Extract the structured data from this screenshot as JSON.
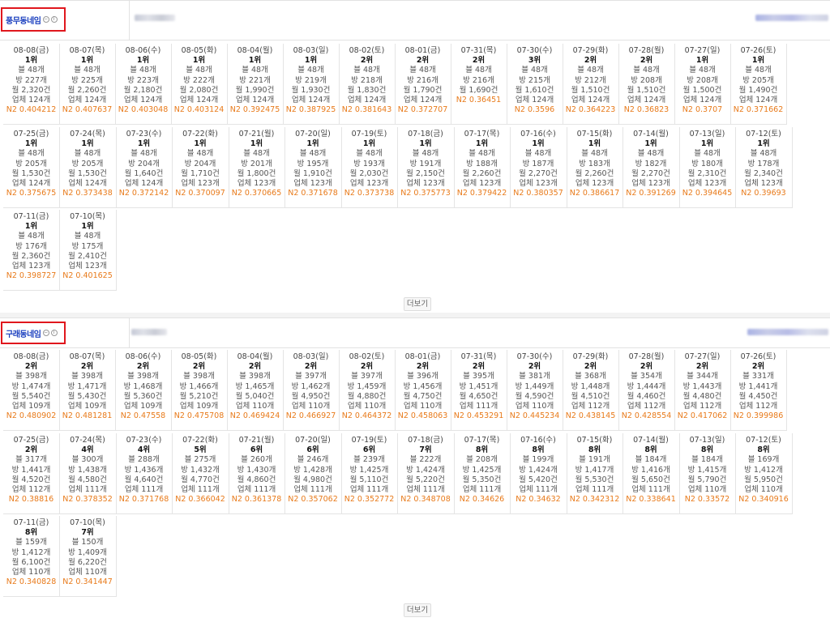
{
  "more_label": "더보기",
  "sections": [
    {
      "name": "풍무동네임",
      "cols_row1": 14,
      "cols_row2": 14,
      "entries": [
        {
          "date": "08-08(금)",
          "rank": "1위",
          "posts": "블 48개",
          "rooms": "방 227개",
          "month": "월 2,320건",
          "biz": "업체 124개",
          "n2": "N2 0.404212"
        },
        {
          "date": "08-07(목)",
          "rank": "1위",
          "posts": "블 48개",
          "rooms": "방 225개",
          "month": "월 2,260건",
          "biz": "업체 124개",
          "n2": "N2 0.407637"
        },
        {
          "date": "08-06(수)",
          "rank": "1위",
          "posts": "블 48개",
          "rooms": "방 223개",
          "month": "월 2,180건",
          "biz": "업체 124개",
          "n2": "N2 0.403048"
        },
        {
          "date": "08-05(화)",
          "rank": "1위",
          "posts": "블 48개",
          "rooms": "방 222개",
          "month": "월 2,080건",
          "biz": "업체 124개",
          "n2": "N2 0.403124"
        },
        {
          "date": "08-04(월)",
          "rank": "1위",
          "posts": "블 48개",
          "rooms": "방 221개",
          "month": "월 1,990건",
          "biz": "업체 124개",
          "n2": "N2 0.392475"
        },
        {
          "date": "08-03(일)",
          "rank": "1위",
          "posts": "블 48개",
          "rooms": "방 219개",
          "month": "월 1,930건",
          "biz": "업체 124개",
          "n2": "N2 0.387925"
        },
        {
          "date": "08-02(토)",
          "rank": "2위",
          "posts": "블 48개",
          "rooms": "방 218개",
          "month": "월 1,830건",
          "biz": "업체 124개",
          "n2": "N2 0.381643"
        },
        {
          "date": "08-01(금)",
          "rank": "2위",
          "posts": "블 48개",
          "rooms": "방 216개",
          "month": "월 1,790건",
          "biz": "업체 124개",
          "n2": "N2 0.372707"
        },
        {
          "date": "07-31(목)",
          "rank": "2위",
          "posts": "블 48개",
          "rooms": "방 216개",
          "month": "월 1,690건",
          "biz": "",
          "n2": "N2 0.36451"
        },
        {
          "date": "07-30(수)",
          "rank": "3위",
          "posts": "블 48개",
          "rooms": "방 215개",
          "month": "월 1,610건",
          "biz": "업체 124개",
          "n2": "N2 0.3596"
        },
        {
          "date": "07-29(화)",
          "rank": "2위",
          "posts": "블 48개",
          "rooms": "방 212개",
          "month": "월 1,510건",
          "biz": "업체 124개",
          "n2": "N2 0.364223"
        },
        {
          "date": "07-28(월)",
          "rank": "2위",
          "posts": "블 48개",
          "rooms": "방 208개",
          "month": "월 1,510건",
          "biz": "업체 124개",
          "n2": "N2 0.36823"
        },
        {
          "date": "07-27(일)",
          "rank": "1위",
          "posts": "블 48개",
          "rooms": "방 208개",
          "month": "월 1,500건",
          "biz": "업체 124개",
          "n2": "N2 0.3707"
        },
        {
          "date": "07-26(토)",
          "rank": "1위",
          "posts": "블 48개",
          "rooms": "방 205개",
          "month": "월 1,490건",
          "biz": "업체 124개",
          "n2": "N2 0.371662"
        },
        {
          "date": "07-25(금)",
          "rank": "1위",
          "posts": "블 48개",
          "rooms": "방 205개",
          "month": "월 1,530건",
          "biz": "업체 124개",
          "n2": "N2 0.375675"
        },
        {
          "date": "07-24(목)",
          "rank": "1위",
          "posts": "블 48개",
          "rooms": "방 205개",
          "month": "월 1,530건",
          "biz": "업체 124개",
          "n2": "N2 0.373438"
        },
        {
          "date": "07-23(수)",
          "rank": "1위",
          "posts": "블 48개",
          "rooms": "방 204개",
          "month": "월 1,640건",
          "biz": "업체 124개",
          "n2": "N2 0.372142"
        },
        {
          "date": "07-22(화)",
          "rank": "1위",
          "posts": "블 48개",
          "rooms": "방 204개",
          "month": "월 1,710건",
          "biz": "업체 123개",
          "n2": "N2 0.370097"
        },
        {
          "date": "07-21(월)",
          "rank": "1위",
          "posts": "블 48개",
          "rooms": "방 201개",
          "month": "월 1,800건",
          "biz": "업체 123개",
          "n2": "N2 0.370665"
        },
        {
          "date": "07-20(일)",
          "rank": "1위",
          "posts": "블 48개",
          "rooms": "방 195개",
          "month": "월 1,910건",
          "biz": "업체 123개",
          "n2": "N2 0.371678"
        },
        {
          "date": "07-19(토)",
          "rank": "1위",
          "posts": "블 48개",
          "rooms": "방 193개",
          "month": "월 2,030건",
          "biz": "업체 123개",
          "n2": "N2 0.373738"
        },
        {
          "date": "07-18(금)",
          "rank": "1위",
          "posts": "블 48개",
          "rooms": "방 191개",
          "month": "월 2,150건",
          "biz": "업체 123개",
          "n2": "N2 0.375773"
        },
        {
          "date": "07-17(목)",
          "rank": "1위",
          "posts": "블 48개",
          "rooms": "방 188개",
          "month": "월 2,260건",
          "biz": "업체 123개",
          "n2": "N2 0.379422"
        },
        {
          "date": "07-16(수)",
          "rank": "1위",
          "posts": "블 48개",
          "rooms": "방 187개",
          "month": "월 2,270건",
          "biz": "업체 123개",
          "n2": "N2 0.380357"
        },
        {
          "date": "07-15(화)",
          "rank": "1위",
          "posts": "블 48개",
          "rooms": "방 183개",
          "month": "월 2,260건",
          "biz": "업체 123개",
          "n2": "N2 0.386617"
        },
        {
          "date": "07-14(월)",
          "rank": "1위",
          "posts": "블 48개",
          "rooms": "방 182개",
          "month": "월 2,270건",
          "biz": "업체 123개",
          "n2": "N2 0.391269"
        },
        {
          "date": "07-13(일)",
          "rank": "1위",
          "posts": "블 48개",
          "rooms": "방 180개",
          "month": "월 2,310건",
          "biz": "업체 123개",
          "n2": "N2 0.394645"
        },
        {
          "date": "07-12(토)",
          "rank": "1위",
          "posts": "블 48개",
          "rooms": "방 178개",
          "month": "월 2,340건",
          "biz": "업체 123개",
          "n2": "N2 0.39693"
        },
        {
          "date": "07-11(금)",
          "rank": "1위",
          "posts": "블 48개",
          "rooms": "방 176개",
          "month": "월 2,360건",
          "biz": "업체 123개",
          "n2": "N2 0.398727"
        },
        {
          "date": "07-10(목)",
          "rank": "1위",
          "posts": "블 48개",
          "rooms": "방 175개",
          "month": "월 2,410건",
          "biz": "업체 123개",
          "n2": "N2 0.401625"
        }
      ]
    },
    {
      "name": "구래동네임",
      "cols_row1": 14,
      "cols_row2": 14,
      "entries": [
        {
          "date": "08-08(금)",
          "rank": "2위",
          "posts": "블 398개",
          "rooms": "방 1,474개",
          "month": "월 5,540건",
          "biz": "업체 109개",
          "n2": "N2 0.480902"
        },
        {
          "date": "08-07(목)",
          "rank": "2위",
          "posts": "블 398개",
          "rooms": "방 1,471개",
          "month": "월 5,430건",
          "biz": "업체 109개",
          "n2": "N2 0.481281"
        },
        {
          "date": "08-06(수)",
          "rank": "2위",
          "posts": "블 398개",
          "rooms": "방 1,468개",
          "month": "월 5,360건",
          "biz": "업체 109개",
          "n2": "N2 0.47558"
        },
        {
          "date": "08-05(화)",
          "rank": "2위",
          "posts": "블 398개",
          "rooms": "방 1,466개",
          "month": "월 5,210건",
          "biz": "업체 109개",
          "n2": "N2 0.475708"
        },
        {
          "date": "08-04(월)",
          "rank": "2위",
          "posts": "블 398개",
          "rooms": "방 1,465개",
          "month": "월 5,040건",
          "biz": "업체 110개",
          "n2": "N2 0.469424"
        },
        {
          "date": "08-03(일)",
          "rank": "2위",
          "posts": "블 397개",
          "rooms": "방 1,462개",
          "month": "월 4,950건",
          "biz": "업체 110개",
          "n2": "N2 0.466927"
        },
        {
          "date": "08-02(토)",
          "rank": "2위",
          "posts": "블 397개",
          "rooms": "방 1,459개",
          "month": "월 4,880건",
          "biz": "업체 110개",
          "n2": "N2 0.464372"
        },
        {
          "date": "08-01(금)",
          "rank": "2위",
          "posts": "블 396개",
          "rooms": "방 1,456개",
          "month": "월 4,750건",
          "biz": "업체 110개",
          "n2": "N2 0.458063"
        },
        {
          "date": "07-31(목)",
          "rank": "2위",
          "posts": "블 395개",
          "rooms": "방 1,451개",
          "month": "월 4,650건",
          "biz": "업체 111개",
          "n2": "N2 0.453291"
        },
        {
          "date": "07-30(수)",
          "rank": "2위",
          "posts": "블 381개",
          "rooms": "방 1,449개",
          "month": "월 4,590건",
          "biz": "업체 110개",
          "n2": "N2 0.445234"
        },
        {
          "date": "07-29(화)",
          "rank": "2위",
          "posts": "블 368개",
          "rooms": "방 1,448개",
          "month": "월 4,510건",
          "biz": "업체 112개",
          "n2": "N2 0.438145"
        },
        {
          "date": "07-28(월)",
          "rank": "2위",
          "posts": "블 354개",
          "rooms": "방 1,444개",
          "month": "월 4,460건",
          "biz": "업체 112개",
          "n2": "N2 0.428554"
        },
        {
          "date": "07-27(일)",
          "rank": "2위",
          "posts": "블 344개",
          "rooms": "방 1,443개",
          "month": "월 4,480건",
          "biz": "업체 112개",
          "n2": "N2 0.417062"
        },
        {
          "date": "07-26(토)",
          "rank": "2위",
          "posts": "블 331개",
          "rooms": "방 1,441개",
          "month": "월 4,450건",
          "biz": "업체 112개",
          "n2": "N2 0.399986"
        },
        {
          "date": "07-25(금)",
          "rank": "2위",
          "posts": "블 317개",
          "rooms": "방 1,441개",
          "month": "월 4,520건",
          "biz": "업체 112개",
          "n2": "N2 0.38816"
        },
        {
          "date": "07-24(목)",
          "rank": "4위",
          "posts": "블 300개",
          "rooms": "방 1,438개",
          "month": "월 4,580건",
          "biz": "업체 111개",
          "n2": "N2 0.378352"
        },
        {
          "date": "07-23(수)",
          "rank": "4위",
          "posts": "블 288개",
          "rooms": "방 1,436개",
          "month": "월 4,640건",
          "biz": "업체 111개",
          "n2": "N2 0.371768"
        },
        {
          "date": "07-22(화)",
          "rank": "5위",
          "posts": "블 275개",
          "rooms": "방 1,432개",
          "month": "월 4,770건",
          "biz": "업체 111개",
          "n2": "N2 0.366042"
        },
        {
          "date": "07-21(월)",
          "rank": "6위",
          "posts": "블 260개",
          "rooms": "방 1,430개",
          "month": "월 4,860건",
          "biz": "업체 111개",
          "n2": "N2 0.361378"
        },
        {
          "date": "07-20(일)",
          "rank": "6위",
          "posts": "블 246개",
          "rooms": "방 1,428개",
          "month": "월 4,980건",
          "biz": "업체 111개",
          "n2": "N2 0.357062"
        },
        {
          "date": "07-19(토)",
          "rank": "6위",
          "posts": "블 239개",
          "rooms": "방 1,425개",
          "month": "월 5,110건",
          "biz": "업체 111개",
          "n2": "N2 0.352772"
        },
        {
          "date": "07-18(금)",
          "rank": "7위",
          "posts": "블 222개",
          "rooms": "방 1,424개",
          "month": "월 5,220건",
          "biz": "업체 111개",
          "n2": "N2 0.348708"
        },
        {
          "date": "07-17(목)",
          "rank": "8위",
          "posts": "블 208개",
          "rooms": "방 1,425개",
          "month": "월 5,350건",
          "biz": "업체 111개",
          "n2": "N2 0.34626"
        },
        {
          "date": "07-16(수)",
          "rank": "8위",
          "posts": "블 199개",
          "rooms": "방 1,424개",
          "month": "월 5,420건",
          "biz": "업체 111개",
          "n2": "N2 0.34632"
        },
        {
          "date": "07-15(화)",
          "rank": "8위",
          "posts": "블 191개",
          "rooms": "방 1,417개",
          "month": "월 5,530건",
          "biz": "업체 111개",
          "n2": "N2 0.342312"
        },
        {
          "date": "07-14(월)",
          "rank": "8위",
          "posts": "블 184개",
          "rooms": "방 1,416개",
          "month": "월 5,650건",
          "biz": "업체 111개",
          "n2": "N2 0.338641"
        },
        {
          "date": "07-13(일)",
          "rank": "8위",
          "posts": "블 184개",
          "rooms": "방 1,415개",
          "month": "월 5,790건",
          "biz": "업체 110개",
          "n2": "N2 0.33572"
        },
        {
          "date": "07-12(토)",
          "rank": "8위",
          "posts": "블 169개",
          "rooms": "방 1,412개",
          "month": "월 5,950건",
          "biz": "업체 110개",
          "n2": "N2 0.340916"
        },
        {
          "date": "07-11(금)",
          "rank": "8위",
          "posts": "블 159개",
          "rooms": "방 1,412개",
          "month": "월 6,100건",
          "biz": "업체 110개",
          "n2": "N2 0.340828"
        },
        {
          "date": "07-10(목)",
          "rank": "7위",
          "posts": "블 150개",
          "rooms": "방 1,409개",
          "month": "월 6,220건",
          "biz": "업체 110개",
          "n2": "N2 0.341447"
        }
      ]
    }
  ]
}
